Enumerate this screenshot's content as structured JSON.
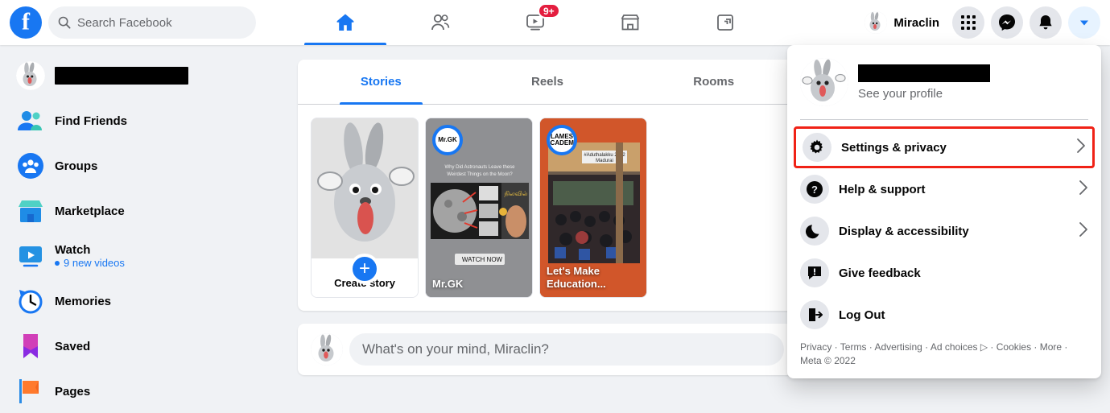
{
  "topbar": {
    "logo_alt": "Facebook",
    "search": {
      "placeholder": "Search Facebook",
      "value": ""
    },
    "nav": [
      {
        "name": "home",
        "icon": "home-icon",
        "active": true,
        "badge": ""
      },
      {
        "name": "friends",
        "icon": "friends-icon",
        "active": false,
        "badge": ""
      },
      {
        "name": "watch",
        "icon": "watch-icon",
        "active": false,
        "badge": "9+"
      },
      {
        "name": "marketplace",
        "icon": "marketplace-icon",
        "active": false,
        "badge": ""
      },
      {
        "name": "groups",
        "icon": "groups-icon",
        "active": false,
        "badge": ""
      }
    ],
    "profile_name": "Miraclin",
    "menu_icon": "grid-menu-icon",
    "messenger_icon": "messenger-icon",
    "notifications_icon": "bell-icon",
    "account_icon": "chevron-down-icon"
  },
  "sidebar": {
    "profile": {
      "name_redacted": true,
      "label": ""
    },
    "items": [
      {
        "label": "Find Friends",
        "icon": "find-friends-icon",
        "sub": ""
      },
      {
        "label": "Groups",
        "icon": "groups-icon",
        "sub": ""
      },
      {
        "label": "Marketplace",
        "icon": "marketplace-icon",
        "sub": ""
      },
      {
        "label": "Watch",
        "icon": "watch-icon",
        "sub": "9 new videos"
      },
      {
        "label": "Memories",
        "icon": "memories-icon",
        "sub": ""
      },
      {
        "label": "Saved",
        "icon": "saved-icon",
        "sub": ""
      },
      {
        "label": "Pages",
        "icon": "pages-icon",
        "sub": ""
      }
    ]
  },
  "feed": {
    "tabs": [
      {
        "label": "Stories",
        "active": true
      },
      {
        "label": "Reels",
        "active": false
      },
      {
        "label": "Rooms",
        "active": false
      }
    ],
    "stories": [
      {
        "type": "create",
        "label": "Create story",
        "plus": "+"
      },
      {
        "type": "story",
        "label": "Mr.GK",
        "ring_text": "Mr.GK",
        "overlay_title": "Why Did Astronauts Leave these Weirdest Things on the Moon?",
        "watch_badge": "WATCH NOW"
      },
      {
        "type": "story",
        "label": "Let's Make Education...",
        "ring_text": "LAMES ACADEMY",
        "overlay_title": "#Aduthalakku 2022 Madurai",
        "watch_badge": ""
      }
    ],
    "composer": {
      "placeholder": "What's on your mind, Miraclin?"
    }
  },
  "dropdown": {
    "profile": {
      "name_redacted": true,
      "see_profile": "See your profile"
    },
    "items": [
      {
        "label": "Settings & privacy",
        "icon": "gear-icon",
        "chevron": "›",
        "highlighted": true
      },
      {
        "label": "Help & support",
        "icon": "help-icon",
        "chevron": "›",
        "highlighted": false
      },
      {
        "label": "Display & accessibility",
        "icon": "moon-icon",
        "chevron": "›",
        "highlighted": false
      },
      {
        "label": "Give feedback",
        "icon": "feedback-icon",
        "chevron": "",
        "highlighted": false
      },
      {
        "label": "Log Out",
        "icon": "logout-icon",
        "chevron": "",
        "highlighted": false
      }
    ],
    "footer": "Privacy · Terms · Advertising · Ad choices ▷ · Cookies · More · Meta © 2022"
  },
  "colors": {
    "brand_blue": "#1877f2",
    "page_bg": "#f0f2f5",
    "badge_red": "#e41e3f",
    "highlight_red": "#f02216",
    "text_primary": "#050505",
    "text_secondary": "#65676b"
  }
}
